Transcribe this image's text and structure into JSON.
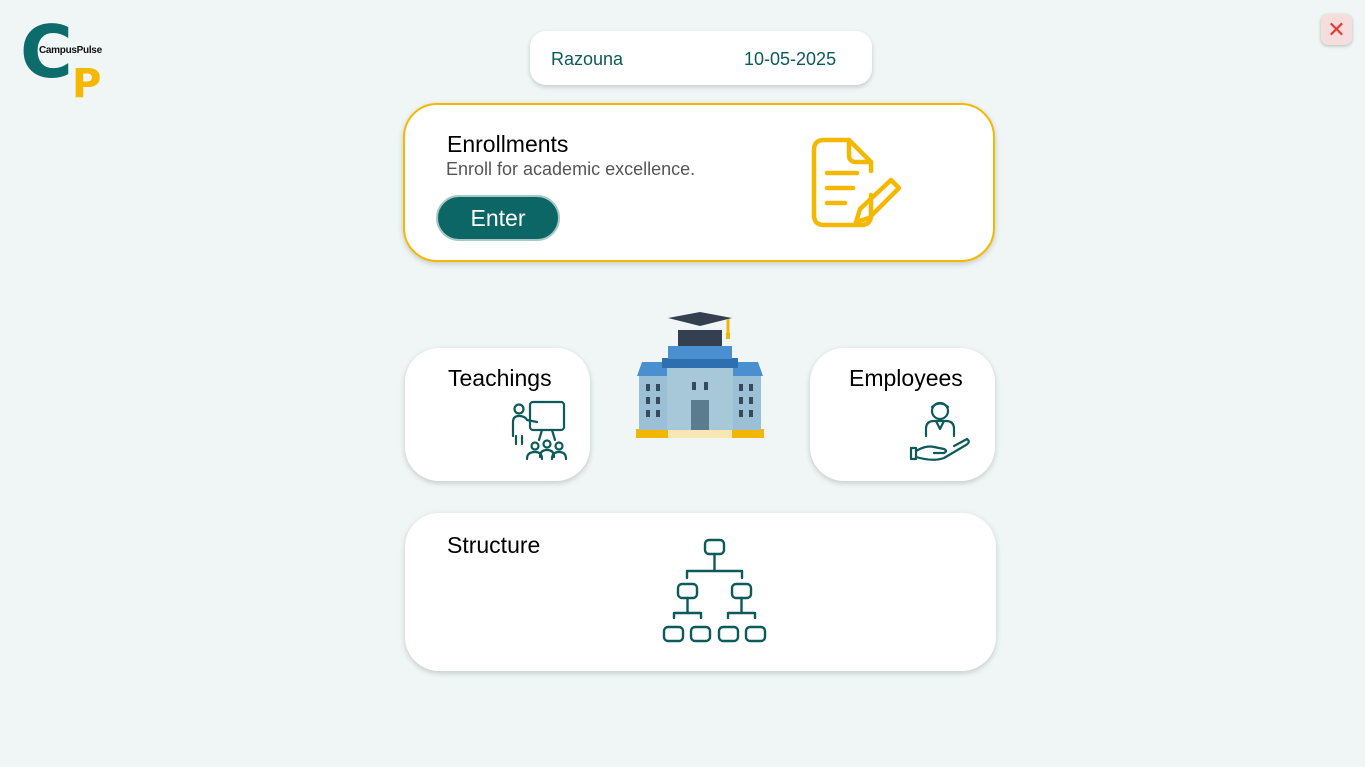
{
  "app": {
    "logo_text": "CampusPulse",
    "logo_letter_c": "C",
    "logo_letter_p": "P",
    "close_symbol": "✕",
    "colors": {
      "primary": "#0c6666",
      "accent": "#f5b800",
      "background": "#eff6f5",
      "close": "#e53935"
    }
  },
  "header": {
    "user_name": "Razouna",
    "date": "10-05-2025"
  },
  "cards": {
    "enrollments": {
      "title": "Enrollments",
      "subtitle": "Enroll for academic excellence.",
      "button_label": "Enter",
      "icon": "document-edit-icon"
    },
    "teachings": {
      "title": "Teachings",
      "icon": "teacher-presentation-icon"
    },
    "employees": {
      "title": "Employees",
      "icon": "employee-care-icon"
    },
    "structure": {
      "title": "Structure",
      "icon": "org-chart-icon"
    }
  },
  "center_illustration": "university-building-icon"
}
